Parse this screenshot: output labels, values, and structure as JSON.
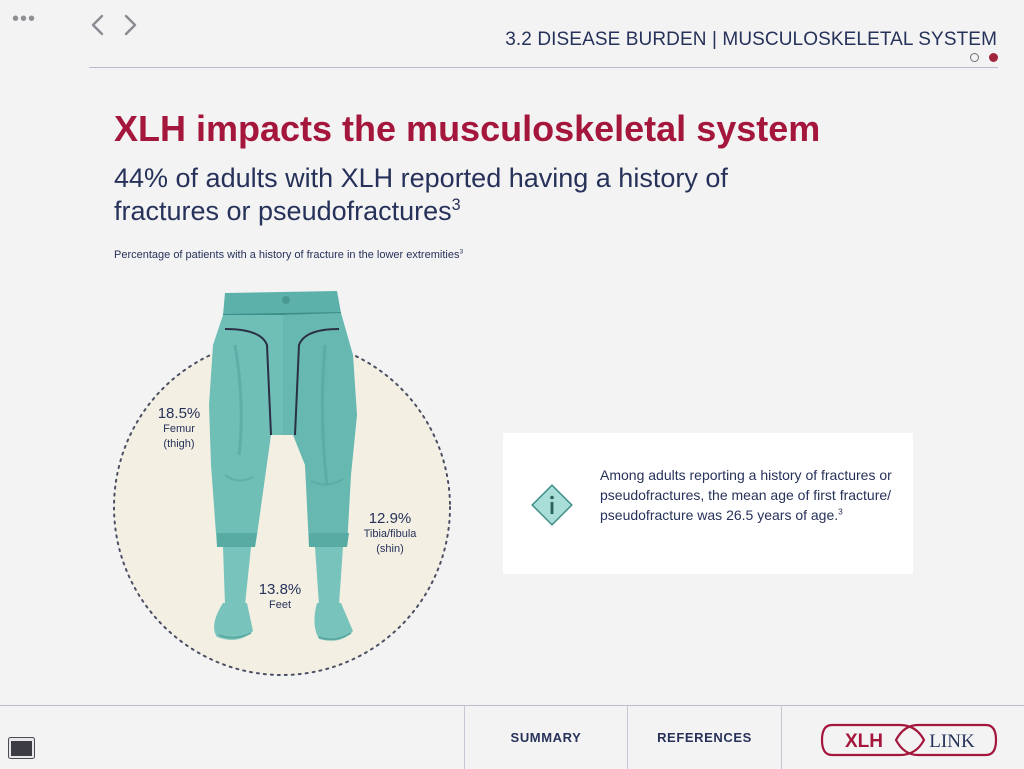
{
  "top_bar": {
    "menu_icon": "more-dots-icon",
    "back_icon": "chevron-left-icon",
    "forward_icon": "chevron-right-icon",
    "section_title": "3.2 DISEASE BURDEN | MUSCULOSKELETAL SYSTEM",
    "pager": {
      "total": 2,
      "active": 2
    }
  },
  "headline": "XLH impacts the musculoskeletal system",
  "subhead": {
    "text": "44% of adults with XLH reported having a history of fractures or pseudofractures",
    "ref": "3"
  },
  "caption": {
    "text": "Percentage of patients with a history of fracture in the lower extremities",
    "ref": "3"
  },
  "figure": {
    "labels": [
      {
        "percent": "18.5%",
        "line1": "Femur",
        "line2": "(thigh)"
      },
      {
        "percent": "12.9%",
        "line1": "Tibia/fibula",
        "line2": "(shin)"
      },
      {
        "percent": "13.8%",
        "line1": "Feet"
      }
    ]
  },
  "info_card": {
    "icon": "info-icon",
    "text": "Among adults reporting a history of fractures or pseudofractures, the mean age of first fracture/ pseudofracture was 26.5 years of age.",
    "ref": "3"
  },
  "footer": {
    "window_icon": "window-icon",
    "summary_label": "SUMMARY",
    "references_label": "REFERENCES",
    "logo_left": "XLH",
    "logo_right": "LINK"
  },
  "colors": {
    "accent": "#a4163b",
    "navy": "#27325a",
    "teal": "#6fbfb7",
    "circle_fill": "#f3efe3",
    "background": "#f3f3f4"
  }
}
